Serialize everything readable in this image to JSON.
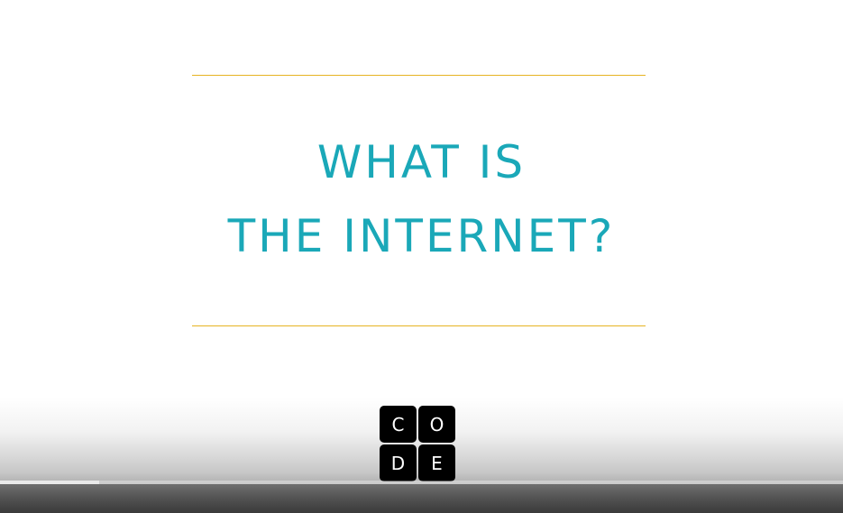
{
  "video": {
    "title_line_1": "WHAT IS",
    "title_line_2": "THE INTERNET?",
    "logo_letters": [
      "C",
      "O",
      "D",
      "E"
    ],
    "progress_fraction": 0.118
  },
  "colors": {
    "title": "#1aa8b8",
    "rule": "#e6b422",
    "logo_tile": "#000000",
    "background": "#ffffff"
  }
}
